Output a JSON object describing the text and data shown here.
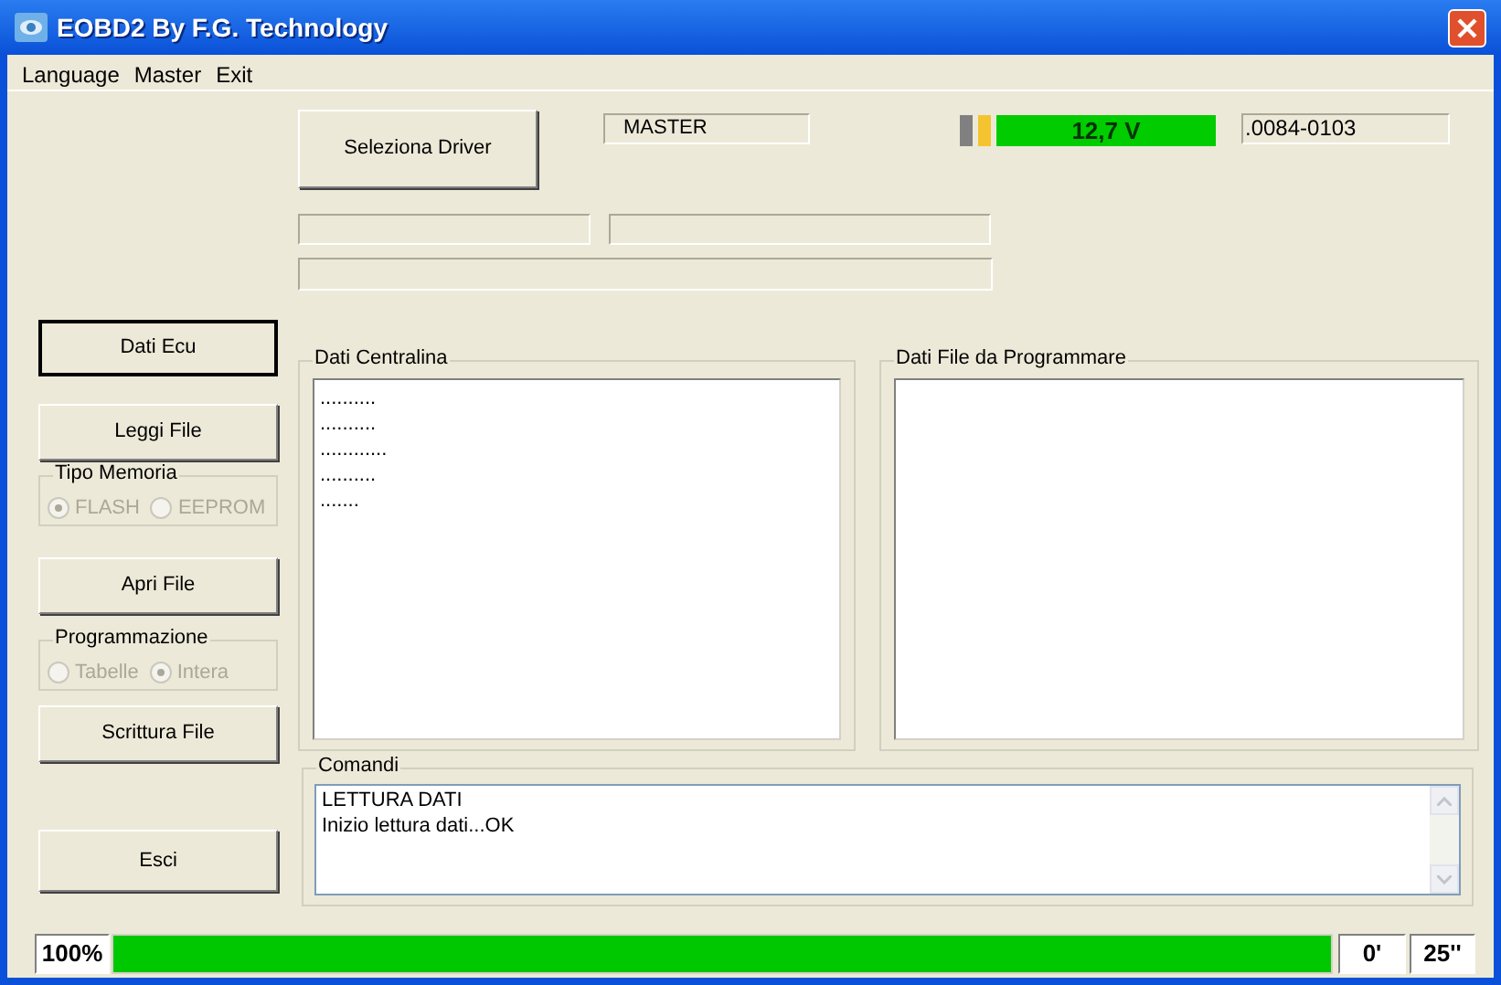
{
  "window": {
    "title": "EOBD2 By F.G. Technology"
  },
  "menu": [
    {
      "label": "Language"
    },
    {
      "label": "Master"
    },
    {
      "label": "Exit"
    }
  ],
  "driver_button": {
    "label": "Seleziona Driver"
  },
  "master_field": {
    "value": "MASTER"
  },
  "battery": {
    "segments": [
      {
        "color": "#808080"
      },
      {
        "color": "#f4c430"
      },
      {
        "color": "#00cc00"
      }
    ],
    "reading": "12,7 V"
  },
  "version_field": {
    "value": ".0084-0103"
  },
  "left_buttons": [
    {
      "kind": "button",
      "label": "Dati Ecu",
      "focused": true
    },
    {
      "kind": "button",
      "label": "Leggi File",
      "focused": false
    },
    {
      "kind": "group",
      "title": "Tipo Memoria",
      "options": [
        {
          "label": "FLASH",
          "selected": true,
          "disabled": true
        },
        {
          "label": "EEPROM",
          "selected": false,
          "disabled": true
        }
      ]
    },
    {
      "kind": "button",
      "label": "Apri File",
      "focused": false
    },
    {
      "kind": "group",
      "title": "Programmazione",
      "options": [
        {
          "label": "Tabelle",
          "selected": false,
          "disabled": true
        },
        {
          "label": "Intera",
          "selected": true,
          "disabled": true
        }
      ]
    },
    {
      "kind": "button",
      "label": "Scrittura File",
      "focused": false
    },
    {
      "kind": "button",
      "label": "Esci",
      "focused": false
    }
  ],
  "panels": [
    {
      "title": "Dati Centralina",
      "lines": [
        "..........",
        "..........",
        "............",
        "..........",
        "......."
      ]
    },
    {
      "title": "Dati File da Programmare"
    }
  ],
  "commands": {
    "title": "Comandi",
    "lines": [
      "LETTURA DATI",
      "Inizio lettura dati...OK"
    ]
  },
  "status_bar": {
    "percent": "100%",
    "level": 1,
    "minutes": "0'",
    "seconds": "25''"
  }
}
